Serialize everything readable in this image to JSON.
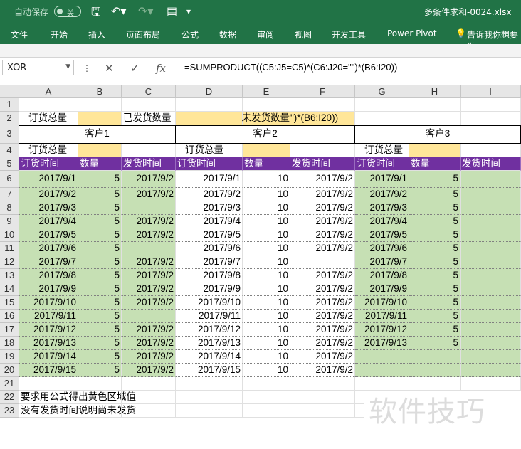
{
  "title": {
    "autosave_label": "自动保存",
    "autosave_state": "关",
    "filename": "多条件求和-0024.xlsx"
  },
  "ribbon": {
    "tabs": [
      "文件",
      "开始",
      "插入",
      "页面布局",
      "公式",
      "数据",
      "审阅",
      "视图",
      "开发工具",
      "Power Pivot",
      "告诉我你想要做"
    ]
  },
  "formula_bar": {
    "name_box": "XOR",
    "formula": "=SUMPRODUCT((C5:J5=C5)*(C6:J20=\"\")*(B6:I20))"
  },
  "columns": [
    "A",
    "B",
    "C",
    "D",
    "E",
    "F",
    "G",
    "H",
    "I"
  ],
  "rows": [
    "1",
    "2",
    "3",
    "4",
    "5",
    "6",
    "7",
    "8",
    "9",
    "10",
    "11",
    "12",
    "13",
    "14",
    "15",
    "16",
    "17",
    "18",
    "19",
    "20",
    "21",
    "22",
    "23"
  ],
  "sheet": {
    "r2": {
      "a": "订货总量",
      "c": "已发货数量",
      "e": "未发货数量",
      "f_overflow": "\")*(B6:I20))"
    },
    "customers": [
      "客户1",
      "客户2",
      "客户3"
    ],
    "r4_label": "订货总量",
    "headers": [
      "订货时间",
      "数量",
      "发货时间"
    ],
    "dates": [
      "2017/9/1",
      "2017/9/2",
      "2017/9/3",
      "2017/9/4",
      "2017/9/5",
      "2017/9/6",
      "2017/9/7",
      "2017/9/8",
      "2017/9/9",
      "2017/9/10",
      "2017/9/11",
      "2017/9/12",
      "2017/9/13",
      "2017/9/14",
      "2017/9/15"
    ],
    "ship_date": "2017/9/2",
    "c1_qty": "5",
    "c2_qty": "10",
    "c3_qty": "5",
    "c1_ship": [
      true,
      true,
      false,
      true,
      true,
      false,
      true,
      true,
      true,
      true,
      false,
      true,
      true,
      true,
      true
    ],
    "c2_ship": [
      true,
      true,
      true,
      true,
      true,
      true,
      false,
      true,
      true,
      true,
      true,
      true,
      true,
      true,
      true
    ],
    "note1": "要求用公式得出黄色区域值",
    "note2": "没有发货时间说明尚未发货"
  },
  "watermark": "软件技巧",
  "colors": {
    "excel_green": "#217346",
    "yellow": "#ffe699",
    "light_green": "#c6e0b4",
    "purple": "#7030a0"
  }
}
